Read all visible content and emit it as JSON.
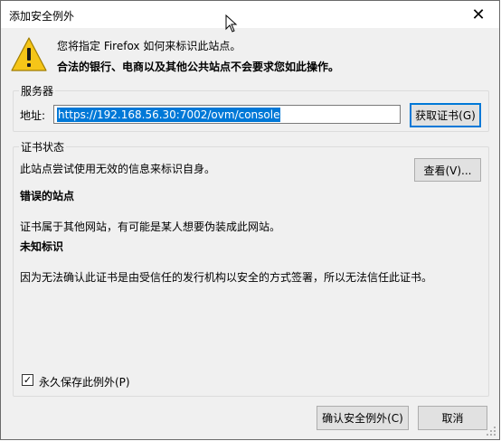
{
  "window": {
    "title": "添加安全例外",
    "close_glyph": "✕"
  },
  "message": {
    "line1": "您将指定 Firefox 如何来标识此站点。",
    "line2": "合法的银行、电商以及其他公共站点不会要求您如此操作。"
  },
  "server": {
    "group_label": "服务器",
    "address_label": "地址:",
    "address_value": "https://192.168.56.30:7002/ovm/console",
    "get_cert_button": "获取证书(G)"
  },
  "cert_status": {
    "group_label": "证书状态",
    "status_text": "此站点尝试使用无效的信息来标识自身。",
    "view_button": "查看(V)...",
    "wrong_site_heading": "错误的站点",
    "wrong_site_text": "证书属于其他网站，有可能是某人想要伪装成此网站。",
    "unknown_identity_heading": "未知标识",
    "unknown_identity_text": "因为无法确认此证书是由受信任的发行机构以安全的方式签署，所以无法信任此证书。"
  },
  "permanent": {
    "checked": true,
    "check_glyph": "✓",
    "label": "永久保存此例外(P)"
  },
  "footer": {
    "confirm_button": "确认安全例外(C)",
    "cancel_button": "取消"
  },
  "colors": {
    "accent": "#0078d7",
    "warning_yellow": "#f5c518"
  }
}
